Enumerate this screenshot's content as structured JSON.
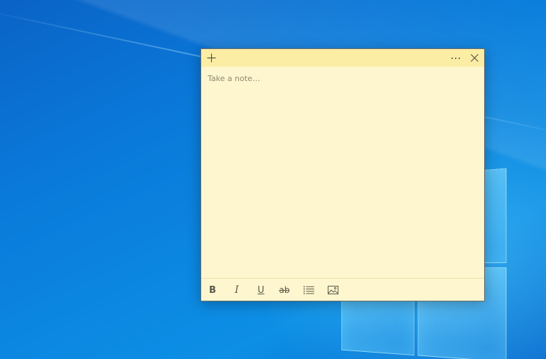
{
  "note": {
    "placeholder": "Take a note…",
    "titlebar": {
      "add_icon": "plus-icon",
      "more_icon": "more-icon",
      "close_icon": "close-icon"
    },
    "format_bar": {
      "bold_label": "B",
      "italic_label": "I",
      "underline_label": "U",
      "strikethrough_label": "ab",
      "bullets_icon": "bullet-list-icon",
      "image_icon": "image-icon"
    }
  },
  "colors": {
    "note_body": "#fdf6cf",
    "note_titlebar": "#fbeda3",
    "desktop_blue": "#0a78d8"
  }
}
